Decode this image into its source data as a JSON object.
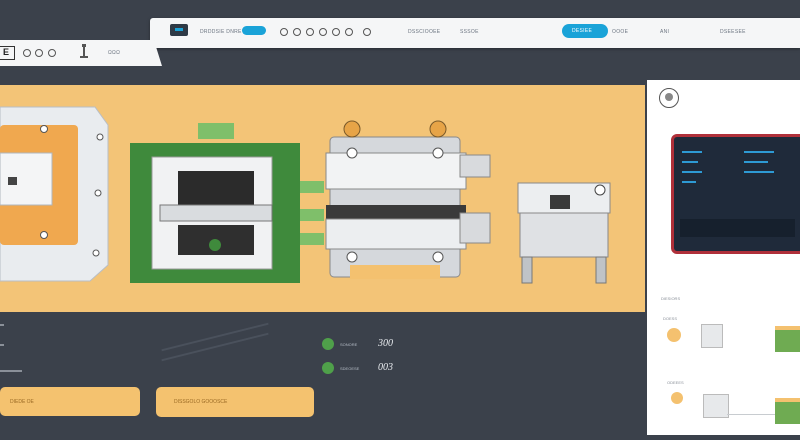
{
  "header": {
    "app_title": "E",
    "left_tab_text": "ΩΩΩ",
    "brand_text": "DRDDSIE DNRE",
    "nav_text_1": "DSSCIOOEE",
    "nav_text_2": "SSSOE",
    "action_button_label": "DESIEE",
    "nav_text_3": "OOOE",
    "nav_text_4": "ANI",
    "nav_text_5": "DSEESEE"
  },
  "stats": [
    {
      "label": "SONORE",
      "value": "300"
    },
    {
      "label": "SDEOESE",
      "value": "003"
    }
  ],
  "bottom_buttons": [
    {
      "label": "DIEDE OE"
    },
    {
      "label": "DISSGOLO GOOOSCE"
    }
  ],
  "right_panel": {
    "section1_label": "DIESIORS",
    "section2_label": "DOESS",
    "section3_label": "ODEEES"
  },
  "colors": {
    "background": "#3b414b",
    "banner": "#f3c477",
    "accent": "#1aa3d8",
    "button": "#f4c26f"
  }
}
